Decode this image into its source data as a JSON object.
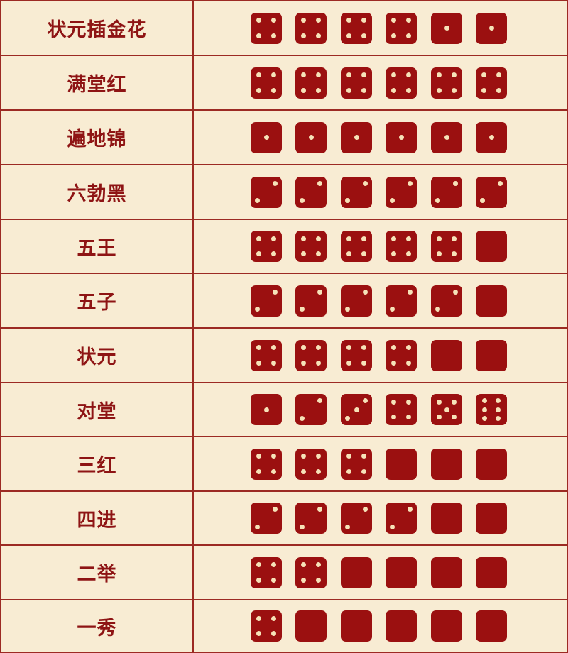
{
  "colors": {
    "background": "#f8ecd3",
    "border": "#9c2a23",
    "die": "#9b1010",
    "pip": "#f6e2b8",
    "text": "#8e1414"
  },
  "rows": [
    {
      "name": "状元插金花",
      "dice": [
        4,
        4,
        4,
        4,
        1,
        1
      ]
    },
    {
      "name": "满堂红",
      "dice": [
        4,
        4,
        4,
        4,
        4,
        4
      ]
    },
    {
      "name": "遍地锦",
      "dice": [
        1,
        1,
        1,
        1,
        1,
        1
      ]
    },
    {
      "name": "六勃黑",
      "dice": [
        2,
        2,
        2,
        2,
        2,
        2
      ]
    },
    {
      "name": "五王",
      "dice": [
        4,
        4,
        4,
        4,
        4,
        0
      ]
    },
    {
      "name": "五子",
      "dice": [
        2,
        2,
        2,
        2,
        2,
        0
      ]
    },
    {
      "name": "状元",
      "dice": [
        4,
        4,
        4,
        4,
        0,
        0
      ]
    },
    {
      "name": "对堂",
      "dice": [
        1,
        2,
        3,
        4,
        5,
        6
      ]
    },
    {
      "name": "三红",
      "dice": [
        4,
        4,
        4,
        0,
        0,
        0
      ]
    },
    {
      "name": "四进",
      "dice": [
        2,
        2,
        2,
        2,
        0,
        0
      ]
    },
    {
      "name": "二举",
      "dice": [
        4,
        4,
        0,
        0,
        0,
        0
      ]
    },
    {
      "name": "一秀",
      "dice": [
        4,
        0,
        0,
        0,
        0,
        0
      ]
    }
  ]
}
